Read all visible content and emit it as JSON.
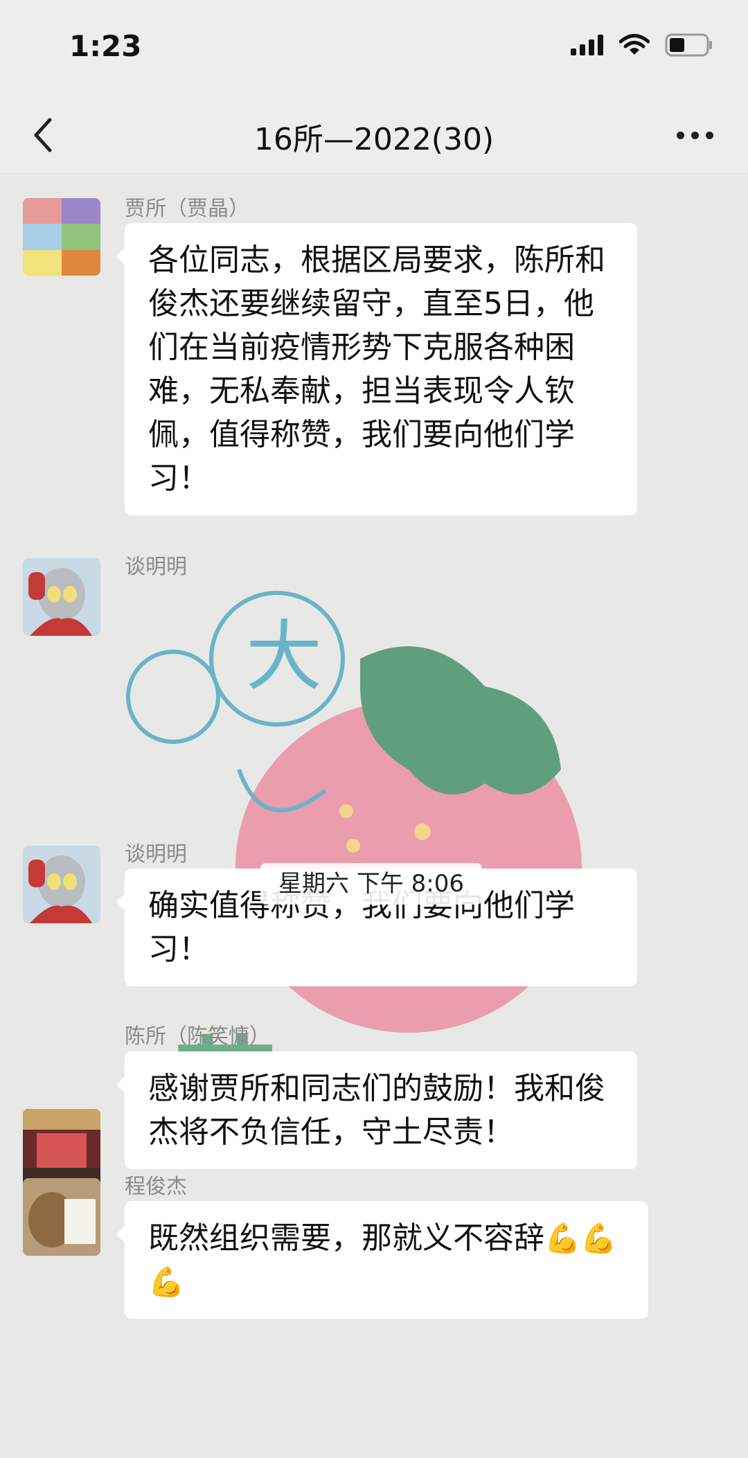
{
  "status_bar": {
    "time": "1:23"
  },
  "nav": {
    "title": "16所—2022(30)"
  },
  "messages": [
    {
      "sender": "贾所（贾晶）",
      "text": "各位同志，根据区局要求，陈所和俊杰还要继续留守，直至5日，他们在当前疫情形势下克服各种困难，无私奉献，担当表现令人钦佩，值得称赞，我们要向他们学习！"
    },
    {
      "sender": "谈明明",
      "text": ""
    },
    {
      "sender": "谈明明",
      "text": "确实值得称赞，我们要向他们学习！"
    },
    {
      "sender": "陈所（陈笑慷）",
      "text": "感谢贾所和同志们的鼓励！我和俊杰将不负信任，守土尽责！"
    },
    {
      "sender": "程俊杰",
      "text": "既然组织需要，那就义不容辞",
      "emoji": "💪💪💪"
    }
  ],
  "timestamp": "星期六 下午 8:06",
  "sticker": {
    "label": "大",
    "name": "heart-strawberry-sticker"
  },
  "colors": {
    "bubble": "#ffffff",
    "background": "#e8e8e6",
    "sticker_green": "#5aa27a",
    "sticker_pink": "#e9879b"
  }
}
